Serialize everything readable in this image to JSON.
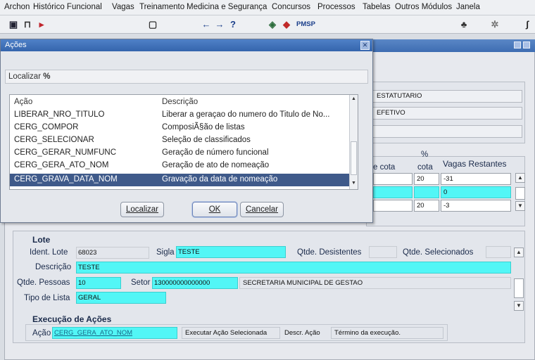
{
  "menu": [
    "Archon",
    "Histórico Funcional",
    "Vagas",
    "Treinamento",
    "Medicina e Segurança",
    "Concursos",
    "Processos",
    "Tabelas",
    "Outros Módulos",
    "Janela"
  ],
  "toolbar": {
    "pmsp": "PMSP"
  },
  "background": {
    "row1_value": "ESTATUTARIO",
    "row2_value": "EFETIVO",
    "table": {
      "col_cota": "e cota",
      "col_pct_top": "%",
      "col_pct_bottom": "cota",
      "col_vagas": "Vagas Restantes",
      "rows": [
        {
          "pct": "20",
          "vagas": "-31"
        },
        {
          "pct": "",
          "vagas": "0"
        },
        {
          "pct": "20",
          "vagas": "-3"
        }
      ]
    },
    "lote": {
      "heading": "Lote",
      "ident_label": "Ident. Lote",
      "ident_value": "68023",
      "sigla_label": "Sigla",
      "sigla_value": "TESTE",
      "desistentes_label": "Qtde. Desistentes",
      "selecionados_label": "Qtde. Selecionados",
      "descricao_label": "Descrição",
      "descricao_value": "TESTE",
      "pessoas_label": "Qtde. Pessoas",
      "pessoas_value": "10",
      "setor_label": "Setor",
      "setor_value": "130000000000000",
      "setor_desc": "SECRETARIA MUNICIPAL DE GESTAO",
      "tipo_label": "Tipo de Lista",
      "tipo_value": "GERAL"
    },
    "execucao": {
      "heading": "Execução de Ações",
      "acao_label": "Ação",
      "acao_value": "CERG_GERA_ATO_NOM",
      "executar_label": "Executar Ação Selecionada",
      "descr_label": "Descr. Ação",
      "descr_value": "Término da execução."
    }
  },
  "dialog": {
    "title": "Ações",
    "find_label": "Localizar",
    "find_value": "%",
    "col_acao": "Ação",
    "col_descricao": "Descrição",
    "rows": [
      {
        "acao": "LIBERAR_NRO_TITULO",
        "desc": "Liberar a geraçao do numero do Titulo de No..."
      },
      {
        "acao": "CERG_COMPOR",
        "desc": "ComposiÃ§ão de listas"
      },
      {
        "acao": "CERG_SELECIONAR",
        "desc": "Seleção de classificados"
      },
      {
        "acao": "CERG_GERAR_NUMFUNC",
        "desc": "Geração de número funcional"
      },
      {
        "acao": "CERG_GERA_ATO_NOM",
        "desc": "Geração de ato de nomeação"
      },
      {
        "acao": "CERG_GRAVA_DATA_NOM",
        "desc": "Gravação da data de nomeação"
      }
    ],
    "selected_index": 5,
    "btn_find": "Localizar",
    "btn_ok": "OK",
    "btn_cancel": "Cancelar"
  }
}
